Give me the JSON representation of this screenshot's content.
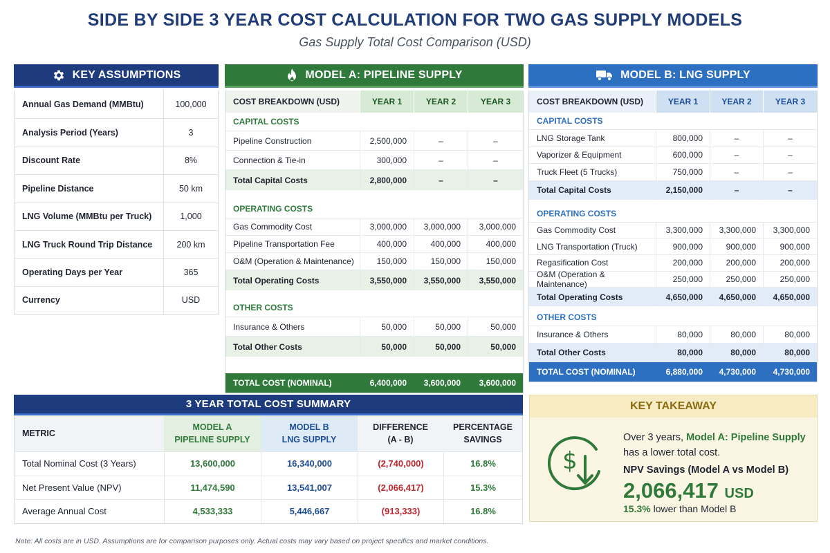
{
  "title": "SIDE BY SIDE 3 YEAR COST CALCULATION FOR TWO GAS SUPPLY MODELS",
  "subtitle": "Gas Supply Total Cost Comparison (USD)",
  "assumptions": {
    "title": "KEY ASSUMPTIONS",
    "icon": "gear-icon",
    "rows": [
      {
        "label": "Annual Gas Demand (MMBtu)",
        "value": "100,000"
      },
      {
        "label": "Analysis Period (Years)",
        "value": "3"
      },
      {
        "label": "Discount Rate",
        "value": "8%"
      },
      {
        "label": "Pipeline Distance",
        "value": "50 km"
      },
      {
        "label": "LNG Volume (MMBtu per Truck)",
        "value": "1,000"
      },
      {
        "label": "LNG Truck Round Trip Distance",
        "value": "200 km"
      },
      {
        "label": "Operating Days per Year",
        "value": "365"
      },
      {
        "label": "Currency",
        "value": "USD"
      }
    ]
  },
  "modelA": {
    "title": "MODEL A: PIPELINE SUPPLY",
    "icon": "flame-icon",
    "header": [
      "COST BREAKDOWN (USD)",
      "YEAR 1",
      "YEAR 2",
      "YEAR 3"
    ],
    "capital_label": "CAPITAL COSTS",
    "capital": [
      [
        "Pipeline Construction",
        "2,500,000",
        "–",
        "–"
      ],
      [
        "Connection & Tie-in",
        "300,000",
        "–",
        "–"
      ]
    ],
    "capital_total": [
      "Total Capital Costs",
      "2,800,000",
      "–",
      "–"
    ],
    "operating_label": "OPERATING COSTS",
    "operating": [
      [
        "Gas Commodity Cost",
        "3,000,000",
        "3,000,000",
        "3,000,000"
      ],
      [
        "Pipeline Transportation Fee",
        "400,000",
        "400,000",
        "400,000"
      ],
      [
        "O&M (Operation & Maintenance)",
        "150,000",
        "150,000",
        "150,000"
      ]
    ],
    "operating_total": [
      "Total Operating Costs",
      "3,550,000",
      "3,550,000",
      "3,550,000"
    ],
    "other_label": "OTHER COSTS",
    "other": [
      [
        "Insurance & Others",
        "50,000",
        "50,000",
        "50,000"
      ]
    ],
    "other_total": [
      "Total Other Costs",
      "50,000",
      "50,000",
      "50,000"
    ],
    "grand_total": [
      "TOTAL COST (NOMINAL)",
      "6,400,000",
      "3,600,000",
      "3,600,000"
    ]
  },
  "modelB": {
    "title": "MODEL B: LNG SUPPLY",
    "icon": "truck-icon",
    "header": [
      "COST BREAKDOWN (USD)",
      "YEAR 1",
      "YEAR 2",
      "YEAR 3"
    ],
    "capital_label": "CAPITAL COSTS",
    "capital": [
      [
        "LNG Storage Tank",
        "800,000",
        "–",
        "–"
      ],
      [
        "Vaporizer & Equipment",
        "600,000",
        "–",
        "–"
      ],
      [
        "Truck Fleet (5 Trucks)",
        "750,000",
        "–",
        "–"
      ]
    ],
    "capital_total": [
      "Total Capital Costs",
      "2,150,000",
      "–",
      "–"
    ],
    "operating_label": "OPERATING COSTS",
    "operating": [
      [
        "Gas Commodity Cost",
        "3,300,000",
        "3,300,000",
        "3,300,000"
      ],
      [
        "LNG Transportation (Truck)",
        "900,000",
        "900,000",
        "900,000"
      ],
      [
        "Regasification Cost",
        "200,000",
        "200,000",
        "200,000"
      ],
      [
        "O&M (Operation & Maintenance)",
        "250,000",
        "250,000",
        "250,000"
      ]
    ],
    "operating_total": [
      "Total Operating Costs",
      "4,650,000",
      "4,650,000",
      "4,650,000"
    ],
    "other_label": "OTHER COSTS",
    "other": [
      [
        "Insurance & Others",
        "80,000",
        "80,000",
        "80,000"
      ]
    ],
    "other_total": [
      "Total Other Costs",
      "80,000",
      "80,000",
      "80,000"
    ],
    "grand_total": [
      "TOTAL COST (NOMINAL)",
      "6,880,000",
      "4,730,000",
      "4,730,000"
    ]
  },
  "summary": {
    "title": "3 YEAR TOTAL COST SUMMARY",
    "header": {
      "metric": "METRIC",
      "a1": "MODEL A",
      "a2": "PIPELINE SUPPLY",
      "b1": "MODEL B",
      "b2": "LNG SUPPLY",
      "d1": "DIFFERENCE",
      "d2": "(A - B)",
      "p1": "PERCENTAGE",
      "p2": "SAVINGS"
    },
    "rows": [
      {
        "metric": "Total Nominal Cost (3 Years)",
        "a": "13,600,000",
        "b": "16,340,000",
        "diff": "(2,740,000)",
        "pct": "16.8%"
      },
      {
        "metric": "Net Present Value (NPV)",
        "a": "11,474,590",
        "b": "13,541,007",
        "diff": "(2,066,417)",
        "pct": "15.3%"
      },
      {
        "metric": "Average Annual Cost",
        "a": "4,533,333",
        "b": "5,446,667",
        "diff": "(913,333)",
        "pct": "16.8%"
      }
    ]
  },
  "takeaway": {
    "title": "KEY TAKEAWAY",
    "icon": "dollar-down-icon",
    "line_pre": "Over 3 years, ",
    "line_model": "Model A: Pipeline Supply",
    "line_post": "has a lower total cost.",
    "npv_label": "NPV Savings (Model A vs Model B)",
    "amount": "2,066,417",
    "currency": "USD",
    "pct": "15.3%",
    "pct_post": " lower than Model B"
  },
  "note": "Note: All costs are in USD. Assumptions are for comparison purposes only. Actual costs may vary based on project specifics and market conditions.",
  "colors": {
    "navy": "#1e3c7d",
    "green": "#2f7a3b",
    "blue": "#2d6fc0",
    "red": "#c0262d",
    "gold": "#8a6d12"
  }
}
